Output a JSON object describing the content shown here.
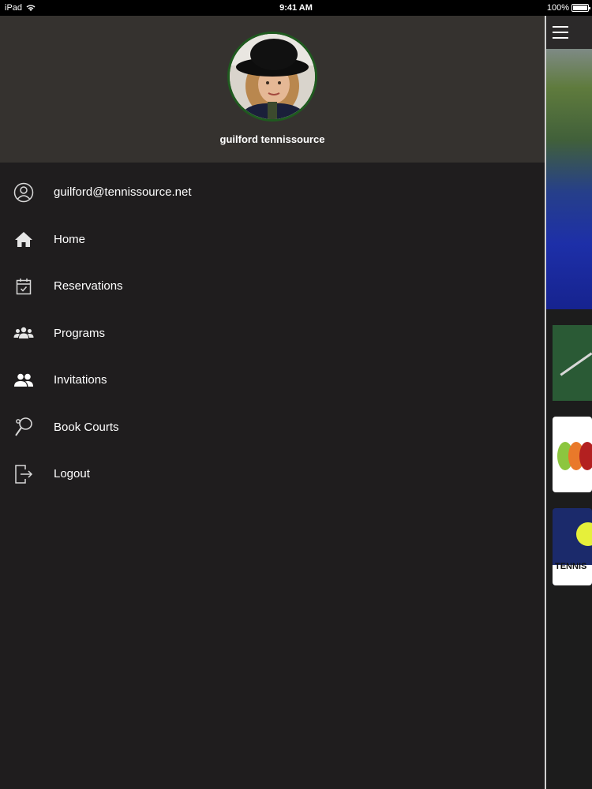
{
  "status_bar": {
    "carrier": "iPad",
    "time": "9:41 AM",
    "battery": "100%"
  },
  "profile": {
    "name": "guilford tennissource"
  },
  "menu": {
    "items": [
      {
        "label": "guilford@tennissource.net",
        "icon": "user-circle-icon"
      },
      {
        "label": "Home",
        "icon": "home-icon"
      },
      {
        "label": "Reservations",
        "icon": "calendar-icon"
      },
      {
        "label": "Programs",
        "icon": "group-icon"
      },
      {
        "label": "Invitations",
        "icon": "people-icon"
      },
      {
        "label": "Book Courts",
        "icon": "racket-icon"
      },
      {
        "label": "Logout",
        "icon": "logout-icon"
      }
    ]
  },
  "main_peek": {
    "card_text": "TENNIS"
  },
  "colors": {
    "drawer_bg": "#1f1d1e",
    "header_bg": "#35322f",
    "accent_green": "#1f5a1f"
  }
}
